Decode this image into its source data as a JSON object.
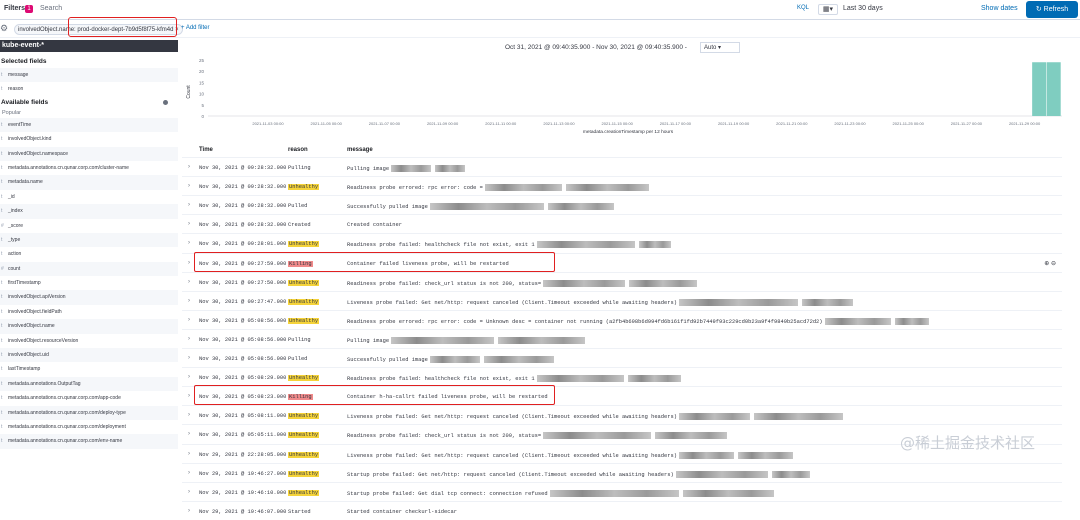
{
  "topbar": {
    "filters_label": "Filters",
    "filter_count": "1",
    "search_placeholder": "Search",
    "kql": "KQL",
    "time_range": "Last 30 days",
    "show_dates": "Show dates",
    "refresh": "Refresh"
  },
  "filterbar": {
    "pill": "involvedObject.name: prod-docker-dept-7b9d5f8f75-kfm4d",
    "add_filter": "+ Add filter"
  },
  "sidebar": {
    "index": "kube-event-*",
    "selected_header": "Selected fields",
    "selected": [
      {
        "type": "t",
        "name": "message"
      },
      {
        "type": "t",
        "name": "reason"
      }
    ],
    "available_header": "Available fields",
    "popular": "Popular",
    "fields": [
      {
        "type": "t",
        "name": "eventTime"
      },
      {
        "type": "t",
        "name": "involvedObject.kind"
      },
      {
        "type": "t",
        "name": "involvedObject.namespace"
      },
      {
        "type": "t",
        "name": "metadata.annotations.cn.qunar.corp.com/cluster-name"
      },
      {
        "type": "t",
        "name": "metadata.name"
      },
      {
        "type": "t",
        "name": "_id"
      },
      {
        "type": "t",
        "name": "_index"
      },
      {
        "type": "#",
        "name": "_score"
      },
      {
        "type": "t",
        "name": "_type"
      },
      {
        "type": "t",
        "name": "action"
      },
      {
        "type": "#",
        "name": "count"
      },
      {
        "type": "t",
        "name": "firstTimestamp"
      },
      {
        "type": "t",
        "name": "involvedObject.apiVersion"
      },
      {
        "type": "t",
        "name": "involvedObject.fieldPath"
      },
      {
        "type": "t",
        "name": "involvedObject.name"
      },
      {
        "type": "t",
        "name": "involvedObject.resourceVersion"
      },
      {
        "type": "t",
        "name": "involvedObject.uid"
      },
      {
        "type": "t",
        "name": "lastTimestamp"
      },
      {
        "type": "t",
        "name": "metadata.annotations.OutputTag"
      },
      {
        "type": "t",
        "name": "metadata.annotations.cn.qunar.corp.com/app-code"
      },
      {
        "type": "t",
        "name": "metadata.annotations.cn.qunar.corp.com/deploy-type"
      },
      {
        "type": "t",
        "name": "metadata.annotations.cn.qunar.corp.com/deployment"
      },
      {
        "type": "t",
        "name": "metadata.annotations.cn.qunar.corp.com/env-name"
      }
    ]
  },
  "chart_header": {
    "time_range": "Oct 31, 2021 @ 09:40:35.900 - Nov 30, 2021 @ 09:40:35.900 -",
    "interval": "Auto"
  },
  "chart_data": {
    "type": "bar",
    "ylabel": "Count",
    "xlabel": "metadata.creationTimestamp per 12 hours",
    "yticks": [
      0,
      5,
      10,
      15,
      20,
      25
    ],
    "ylim": [
      0,
      25
    ],
    "x_ticks": [
      "2021-11-03 00:00",
      "2021-11-05 00:00",
      "2021-11-07 00:00",
      "2021-11-09 00:00",
      "2021-11-11 00:00",
      "2021-11-13 00:00",
      "2021-11-15 00:00",
      "2021-11-17 00:00",
      "2021-11-19 00:00",
      "2021-11-21 00:00",
      "2021-11-23 00:00",
      "2021-11-25 00:00",
      "2021-11-27 00:00",
      "2021-11-29 00:00"
    ],
    "bars": [
      {
        "x": "2021-11-29 12:00",
        "value": 24
      },
      {
        "x": "2021-11-30 00:00",
        "value": 24
      }
    ],
    "bar_color": "#7fcdc0"
  },
  "table": {
    "headers": {
      "time": "Time",
      "reason": "reason",
      "message": "message"
    },
    "rows": [
      {
        "time": "Nov 30, 2021 @ 09:28:32.000",
        "reason": "Pulling",
        "hl": "",
        "msg": "Pulling image"
      },
      {
        "time": "Nov 30, 2021 @ 09:28:32.000",
        "reason": "Unhealthy",
        "hl": "y",
        "msg": "Readiness probe errored: rpc error: code ="
      },
      {
        "time": "Nov 30, 2021 @ 09:28:32.000",
        "reason": "Pulled",
        "hl": "",
        "msg": "Successfully pulled image"
      },
      {
        "time": "Nov 30, 2021 @ 09:28:32.000",
        "reason": "Created",
        "hl": "",
        "msg": "Created container"
      },
      {
        "time": "Nov 30, 2021 @ 09:28:01.000",
        "reason": "Unhealthy",
        "hl": "y",
        "msg": "Readiness probe failed:  healthcheck file not exist, exit 1"
      },
      {
        "time": "Nov 30, 2021 @ 09:27:59.000",
        "reason": "Killing",
        "hl": "r",
        "msg": "Container          failed liveness probe, will be restarted"
      },
      {
        "time": "Nov 30, 2021 @ 09:27:50.000",
        "reason": "Unhealthy",
        "hl": "y",
        "msg": "Readiness probe failed: check_url status is not 200, status="
      },
      {
        "time": "Nov 30, 2021 @ 09:27:47.000",
        "reason": "Unhealthy",
        "hl": "y",
        "msg": "Liveness probe failed: Get                              net/http: request canceled (Client.Timeout exceeded while awaiting headers)"
      },
      {
        "time": "Nov 30, 2021 @ 05:08:56.000",
        "reason": "Unhealthy",
        "hl": "y",
        "msg": "Readiness probe errored: rpc error: code = Unknown desc = container not running (a2fb4b698b6d994fd6b161f1fd92b7449f93c229cd0b23a9f4f9849b25acd72d2)"
      },
      {
        "time": "Nov 30, 2021 @ 05:08:56.000",
        "reason": "Pulling",
        "hl": "",
        "msg": "Pulling image"
      },
      {
        "time": "Nov 30, 2021 @ 05:08:56.000",
        "reason": "Pulled",
        "hl": "",
        "msg": "Successfully pulled image"
      },
      {
        "time": "Nov 30, 2021 @ 05:08:29.000",
        "reason": "Unhealthy",
        "hl": "y",
        "msg": "Readiness probe failed:  healthcheck file not exist, exit 1"
      },
      {
        "time": "Nov 30, 2021 @ 05:08:23.000",
        "reason": "Killing",
        "hl": "r",
        "msg": "Container h-ha-callrt failed liveness probe, will be restarted"
      },
      {
        "time": "Nov 30, 2021 @ 05:08:11.000",
        "reason": "Unhealthy",
        "hl": "y",
        "msg": "Liveness probe failed: Get                              net/http: request canceled (Client.Timeout exceeded while awaiting headers)"
      },
      {
        "time": "Nov 30, 2021 @ 05:05:11.000",
        "reason": "Unhealthy",
        "hl": "y",
        "msg": "Readiness probe failed: check_url status is not 200, status="
      },
      {
        "time": "Nov 29, 2021 @ 22:28:05.000",
        "reason": "Unhealthy",
        "hl": "y",
        "msg": "Liveness probe failed: Get                              net/http: request canceled (Client.Timeout exceeded while awaiting headers)"
      },
      {
        "time": "Nov 29, 2021 @ 19:46:27.000",
        "reason": "Unhealthy",
        "hl": "y",
        "msg": "Startup probe failed: Get                              net/http: request canceled (Client.Timeout exceeded while awaiting headers)"
      },
      {
        "time": "Nov 29, 2021 @ 19:46:10.000",
        "reason": "Unhealthy",
        "hl": "y",
        "msg": "Startup probe failed: Get               dial tcp               connect: connection refused"
      },
      {
        "time": "Nov 29, 2021 @ 19:46:07.000",
        "reason": "Started",
        "hl": "",
        "msg": "Started container checkurl-sidecar"
      }
    ]
  },
  "watermark": "@稀土掘金技术社区"
}
